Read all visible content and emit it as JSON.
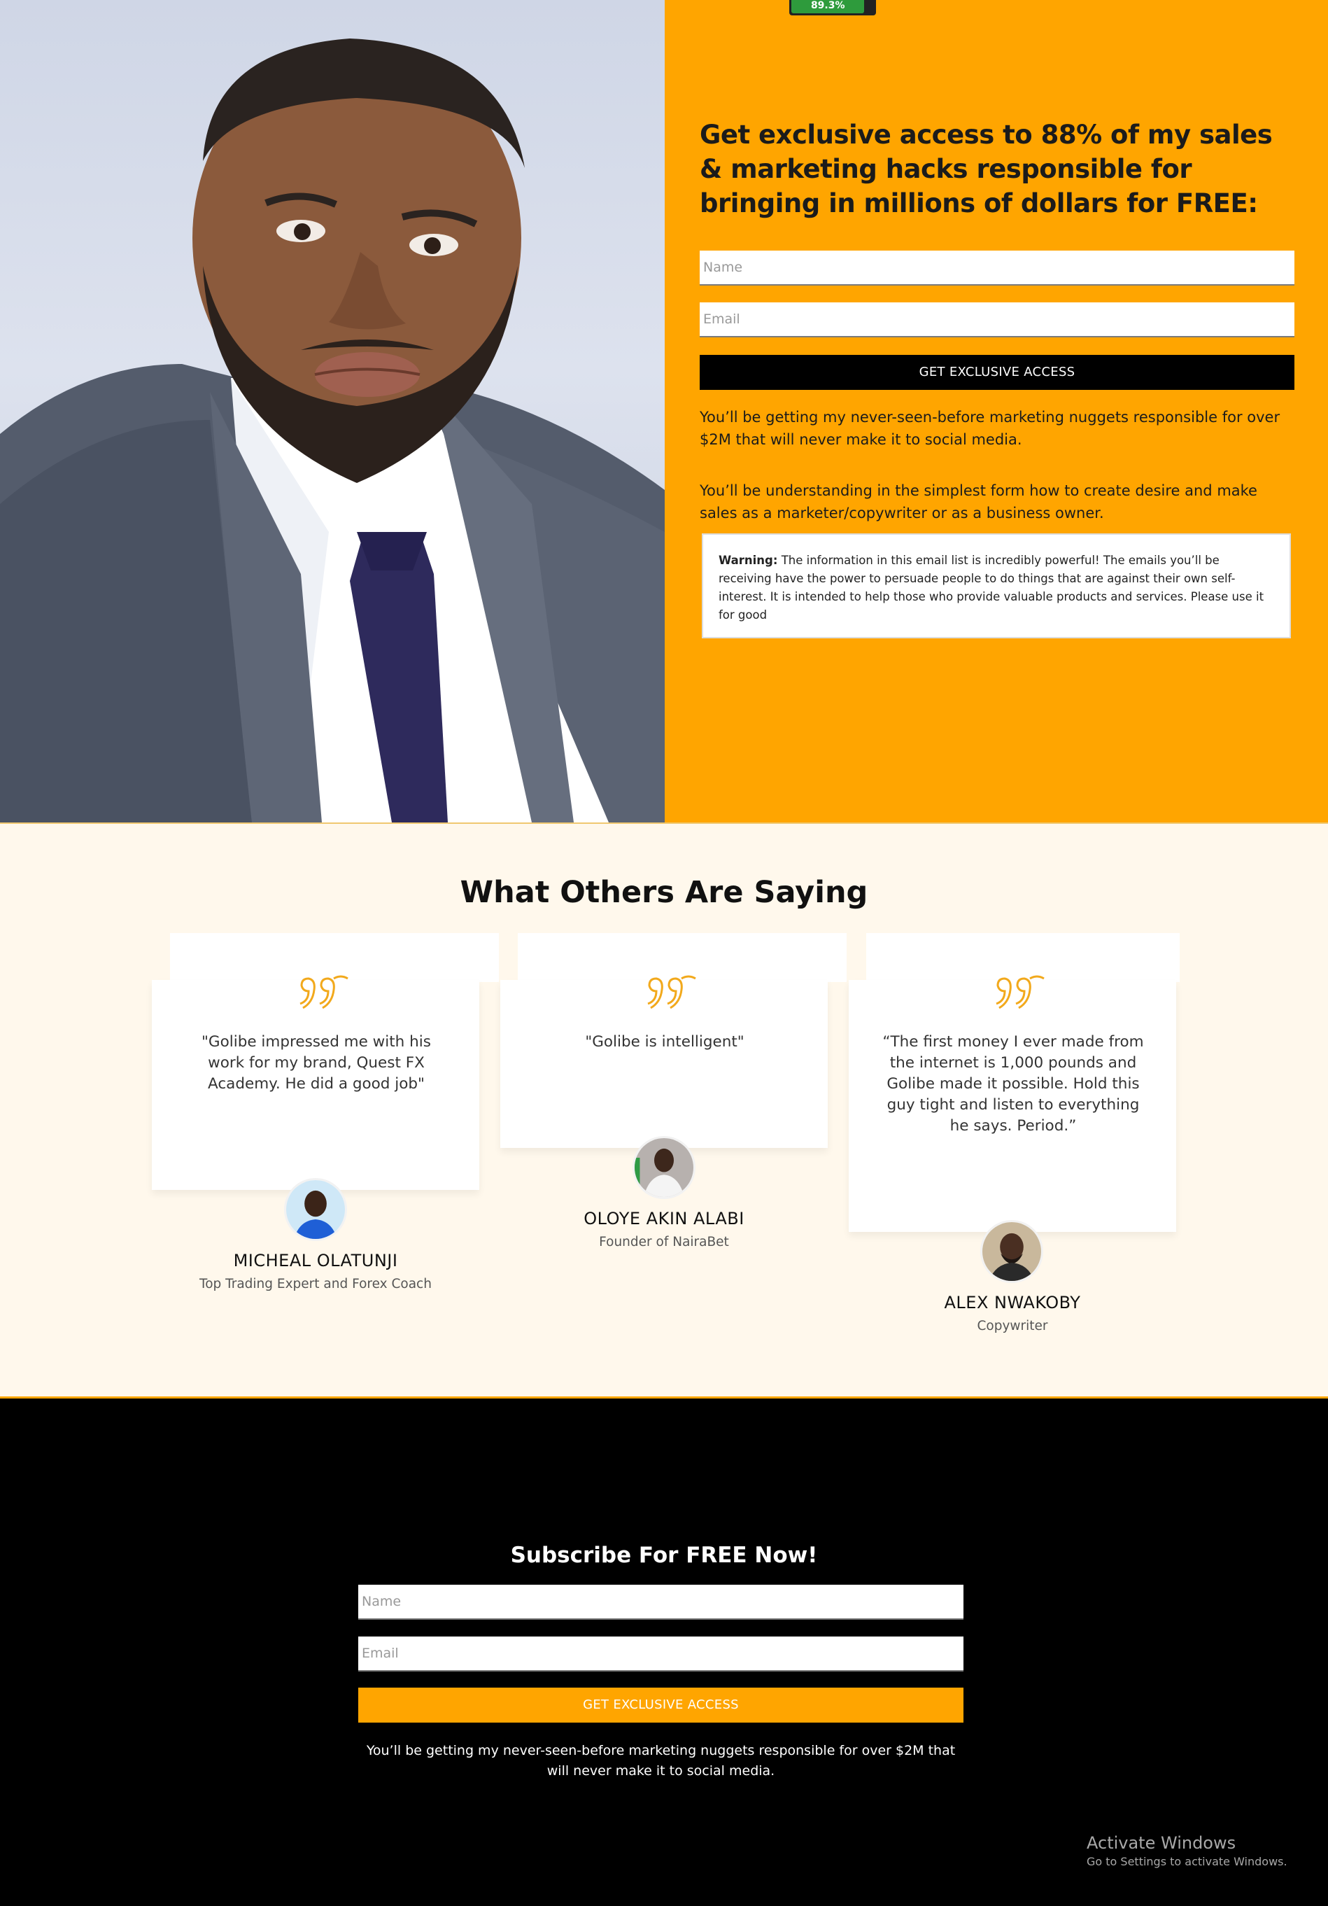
{
  "hero": {
    "progress_label": "89.3%",
    "progress_value": 0.893,
    "headline": "Get exclusive access to 88% of my sales & marketing hacks responsible for bringing in millions of dollars for FREE:",
    "name_placeholder": "Name",
    "email_placeholder": "Email",
    "cta_label": "GET EXCLUSIVE ACCESS",
    "paragraph1": "You’ll be getting my never-seen-before marketing nuggets responsible for over $2M that will never make it to social media.",
    "paragraph2": "You’ll be understanding in the simplest form how to create desire and make sales as a marketer/copywriter or as a business owner.",
    "warning_label": "Warning:",
    "warning_text": " The information in this email list is incredibly powerful! The emails you’ll be receiving have the power to persuade people to do things that are against their own self-interest. It is intended to help those who provide valuable products and services. Please use it for good"
  },
  "testimonials": {
    "title": "What Others Are Saying",
    "items": [
      {
        "quote": "\"Golibe impressed me with his work for my brand, Quest FX Academy. He did a good job\"",
        "name": "MICHEAL OLATUNJI",
        "role": "Top Trading Expert and Forex Coach"
      },
      {
        "quote": "\"Golibe is intelligent\"",
        "name": "OLOYE AKIN ALABI",
        "role": "Founder of NairaBet"
      },
      {
        "quote": "“The first money I ever made from the internet is 1,000 pounds and Golibe made it possible. Hold this guy tight and listen to everything he says. Period.”",
        "name": "ALEX NWAKOBY",
        "role": "Copywriter"
      }
    ]
  },
  "subscribe": {
    "title": "Subscribe For FREE Now!",
    "name_placeholder": "Name",
    "email_placeholder": "Email",
    "cta_label": "GET EXCLUSIVE ACCESS",
    "text": "You’ll be getting my never-seen-before marketing nuggets responsible for over $2M that will never make it to social media."
  },
  "watermark": {
    "title": "Activate Windows",
    "subtitle": "Go to Settings to activate Windows."
  },
  "colors": {
    "accent": "#ffa500",
    "dark": "#000000",
    "cream": "#fff8ec",
    "quote_icon": "#f2a91c"
  },
  "icons": [
    "quote-icon",
    "portrait-photo",
    "avatar-photo"
  ]
}
